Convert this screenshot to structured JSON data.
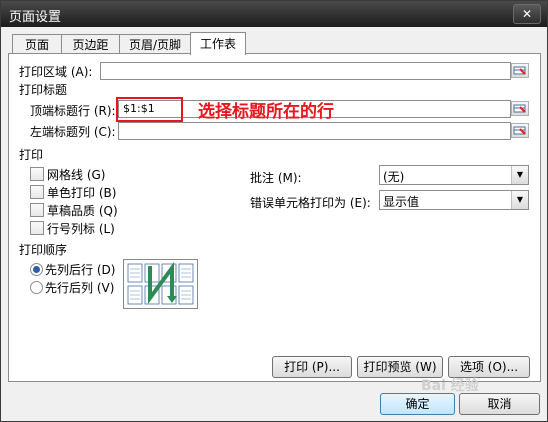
{
  "window": {
    "title": "页面设置",
    "close": "✕"
  },
  "tabs": [
    {
      "label": "页面"
    },
    {
      "label": "页边距"
    },
    {
      "label": "页眉/页脚"
    },
    {
      "label": "工作表"
    }
  ],
  "print_area": {
    "label": "打印区域 (A):",
    "value": ""
  },
  "print_titles": {
    "heading": "打印标题",
    "rows": {
      "label": "顶端标题行 (R):",
      "value": "$1:$1"
    },
    "cols": {
      "label": "左端标题列 (C):",
      "value": ""
    }
  },
  "annotation": "选择标题所在的行",
  "print": {
    "heading": "打印",
    "checkboxes": [
      {
        "label": "网格线 (G)",
        "checked": false
      },
      {
        "label": "单色打印 (B)",
        "checked": false
      },
      {
        "label": "草稿品质 (Q)",
        "checked": false
      },
      {
        "label": "行号列标 (L)",
        "checked": false
      }
    ],
    "comments": {
      "label": "批注 (M):",
      "value": "(无)"
    },
    "errors": {
      "label": "错误单元格打印为 (E):",
      "value": "显示值"
    }
  },
  "page_order": {
    "heading": "打印顺序",
    "options": [
      {
        "label": "先列后行 (D)",
        "selected": true
      },
      {
        "label": "先行后列 (V)",
        "selected": false
      }
    ]
  },
  "buttons": {
    "print": "打印 (P)...",
    "preview": "打印预览 (W)",
    "options": "选项 (O)...",
    "ok": "确定",
    "cancel": "取消"
  },
  "watermark": "Bai 经验"
}
